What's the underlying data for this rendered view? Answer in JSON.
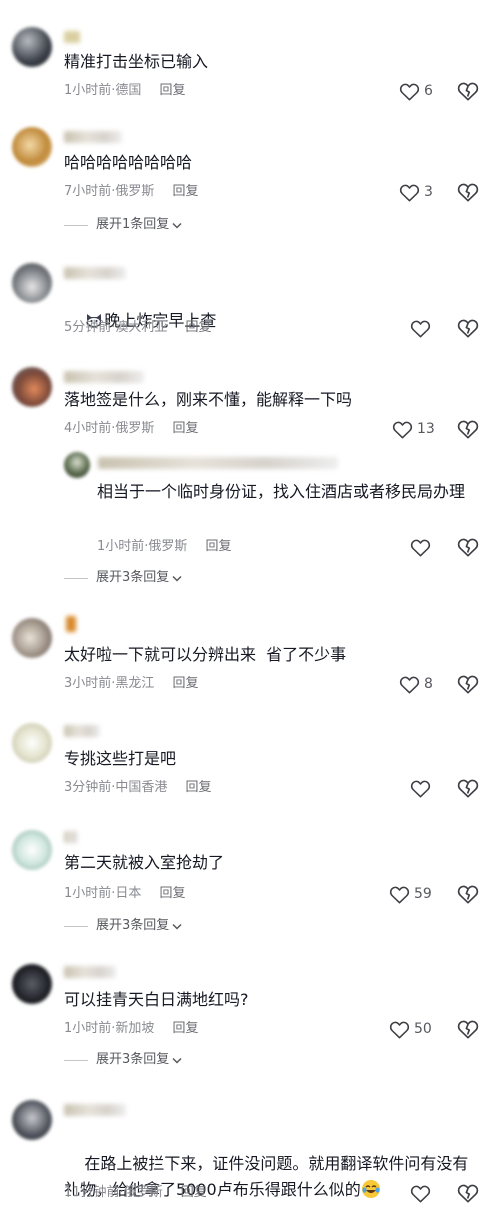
{
  "comments": [
    {
      "text": "精准打击坐标已输入",
      "time": "1小时前",
      "loc": "德国",
      "reply": "回复",
      "likes": "6"
    },
    {
      "text": "哈哈哈哈哈哈哈哈",
      "time": "7小时前",
      "loc": "俄罗斯",
      "reply": "回复",
      "likes": "3",
      "expand": "展开1条回复"
    },
    {
      "text": "晚上炸完早上查",
      "time": "5分钟前",
      "loc": "澳大利亚",
      "reply": "回复",
      "likes": ""
    },
    {
      "text": "落地签是什么，刚来不懂，能解释一下吗",
      "time": "4小时前",
      "loc": "俄罗斯",
      "reply": "回复",
      "likes": "13",
      "sub": {
        "text": "相当于一个临时身份证，找入住酒店或者移民局办理",
        "time": "1小时前",
        "loc": "俄罗斯",
        "reply": "回复",
        "likes": ""
      },
      "expand": "展开3条回复"
    },
    {
      "text": "太好啦一下就可以分辨出来  省了不少事",
      "time": "3小时前",
      "loc": "黑龙江",
      "reply": "回复",
      "likes": "8"
    },
    {
      "text": "专挑这些打是吧",
      "time": "3分钟前",
      "loc": "中国香港",
      "reply": "回复",
      "likes": ""
    },
    {
      "text": "第二天就被入室抢劫了",
      "time": "1小时前",
      "loc": "日本",
      "reply": "回复",
      "likes": "59",
      "expand": "展开3条回复"
    },
    {
      "text": "可以挂青天白日满地红吗?",
      "time": "1小时前",
      "loc": "新加坡",
      "reply": "回复",
      "likes": "50",
      "expand": "展开3条回复"
    },
    {
      "text": "在路上被拦下来，证件没问题。就用翻译软件问有没有礼物，给他拿了5000卢布乐得跟什么似的",
      "time": "11分钟前",
      "loc": "俄罗斯",
      "reply": "回复",
      "likes": ""
    }
  ],
  "separator": "·",
  "icons": {
    "like": "heart-outline-icon",
    "dislike": "broken-heart-icon",
    "expand": "chevron-down-icon",
    "emoji_cat": "cat-emoji-icon",
    "emoji_laugh": "tears-of-joy-emoji-icon"
  }
}
